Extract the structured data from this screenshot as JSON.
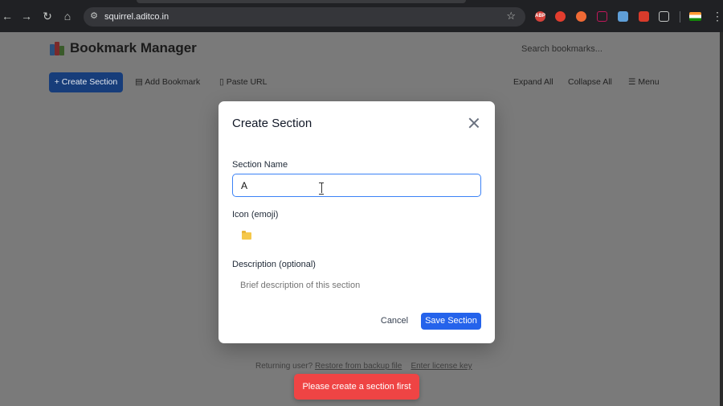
{
  "browser": {
    "url": "squirrel.aditco.in",
    "icons": [
      "back-icon",
      "forward-icon",
      "reload-icon",
      "home-icon",
      "site-info-icon",
      "bookmark-star-icon",
      "adblock-icon",
      "extensions-icon",
      "menu-icon"
    ],
    "abp_label": "ABP"
  },
  "app": {
    "title": "Bookmark Manager",
    "search_placeholder": "Search bookmarks..."
  },
  "toolbar": {
    "create_section": "+ Create Section",
    "add_bookmark": "Add Bookmark",
    "paste_url": "Paste URL",
    "expand_all": "Expand All",
    "collapse_all": "Collapse All",
    "menu": "☰ Menu"
  },
  "modal": {
    "title": "Create Section",
    "name_label": "Section Name",
    "name_value": "A",
    "icon_label": "Icon (emoji)",
    "icon_value": "folder",
    "desc_label": "Description (optional)",
    "desc_placeholder": "Brief description of this section",
    "cancel": "Cancel",
    "save": "Save Section"
  },
  "footer": {
    "prefix": "Returning user?",
    "restore_link": "Restore from backup file",
    "license_link": "Enter license key"
  },
  "toast": {
    "message": "Please create a section first"
  },
  "colors": {
    "primary": "#2563eb",
    "toast": "#ef4444",
    "overlay": "#7a7a7a"
  }
}
